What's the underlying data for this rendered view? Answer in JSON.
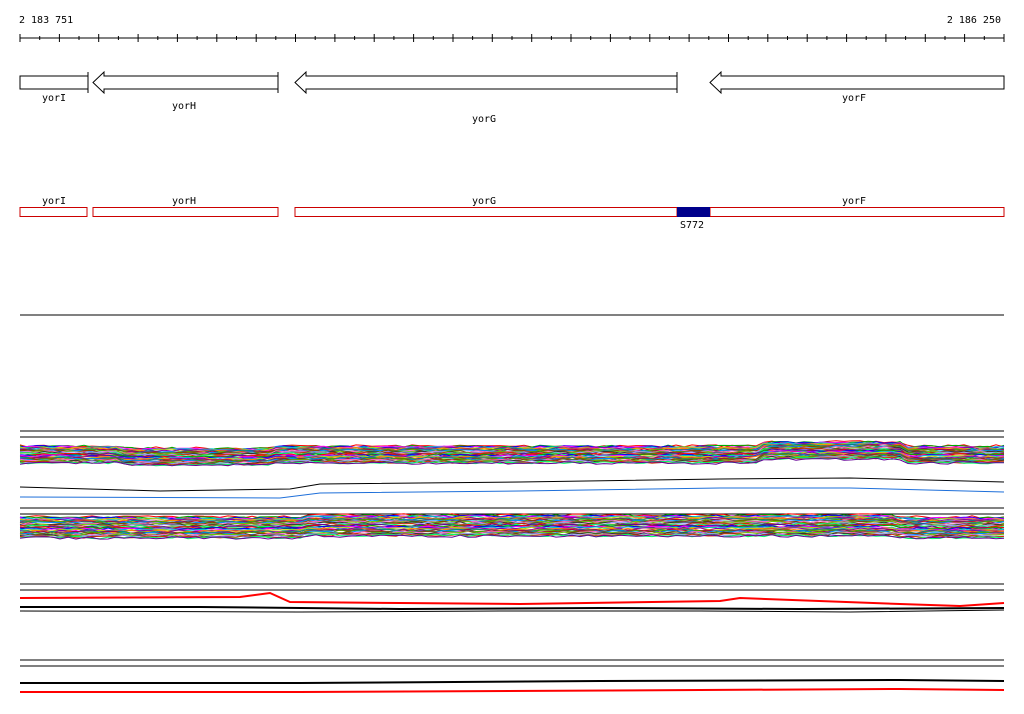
{
  "coordinates": {
    "start": "2 183 751",
    "end": "2 186 250"
  },
  "genes": [
    {
      "name": "yorI",
      "strand": "-"
    },
    {
      "name": "yorH",
      "strand": "-"
    },
    {
      "name": "yorG",
      "strand": "-"
    },
    {
      "name": "yorF",
      "strand": "-"
    }
  ],
  "transcripts": [
    {
      "name": "yorI"
    },
    {
      "name": "yorH"
    },
    {
      "name": "yorG"
    },
    {
      "name": "yorF"
    }
  ],
  "feature": {
    "name": "S772",
    "color": "#00008b"
  },
  "colors": {
    "gene_outline": "#000000",
    "transcript_outline": "#cc0000",
    "red_trace": "#ff0000",
    "blue_trace": "#1e6fd9"
  }
}
